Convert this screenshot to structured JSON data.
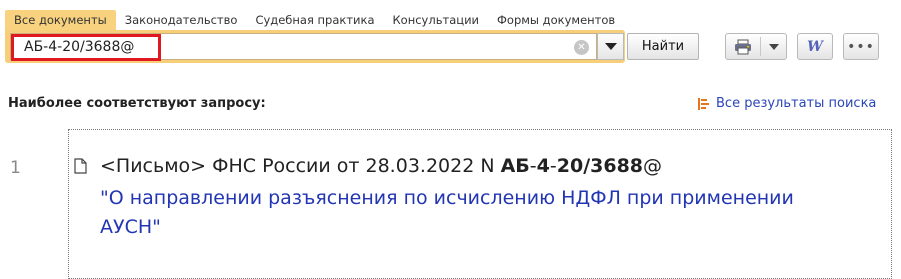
{
  "tabs": [
    {
      "label": "Все документы",
      "active": true
    },
    {
      "label": "Законодательство"
    },
    {
      "label": "Судебная практика"
    },
    {
      "label": "Консультации"
    },
    {
      "label": "Формы документов"
    }
  ],
  "search": {
    "query": "АБ-4-20/3688@",
    "clear_icon": "clear-circle-icon",
    "dropdown_icon": "chevron-down-icon",
    "find_label": "Найти"
  },
  "toolbar": {
    "print_icon": "printer-icon",
    "word_icon": "word-export-icon",
    "word_glyph": "W",
    "more_icon": "more-dots-icon",
    "more_glyph": "•••"
  },
  "results": {
    "heading": "Наиболее соответствуют запросу:",
    "all_results_label": "Все результаты поиска",
    "items": [
      {
        "number": "1",
        "prefix": "<Письмо> ФНС России от 28.03.2022 N ",
        "code_parts": [
          "АБ",
          "-",
          "4",
          "-",
          "20",
          "/",
          "3688",
          "@"
        ],
        "title": "\"О направлении разъяснения по исчислению НДФЛ при применении АУСН\""
      }
    ]
  },
  "colors": {
    "accent": "#f7ce79",
    "highlight": "#e01820",
    "link": "#2236b3"
  }
}
